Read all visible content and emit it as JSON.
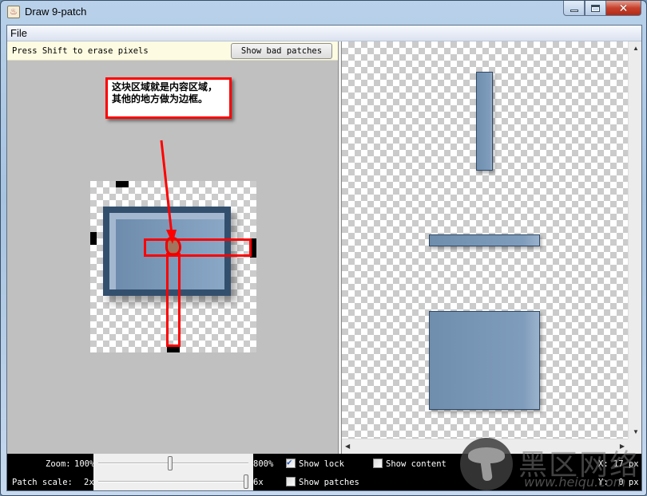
{
  "window": {
    "title": "Draw 9-patch",
    "app_icon": "java-cup-icon",
    "controls": {
      "minimize": "minimize-icon",
      "maximize": "maximize-icon",
      "close": "close-icon"
    }
  },
  "menubar": {
    "items": [
      {
        "label": "File"
      }
    ]
  },
  "editor": {
    "hint": "Press Shift to erase pixels",
    "show_bad_patches_label": "Show bad patches",
    "annotation": {
      "lines": [
        "这块区域就是内容区域，",
        "其他的地方做为边框。"
      ]
    },
    "annotation_color": "#ff0000"
  },
  "preview": {
    "items": [
      {
        "name": "vertical-stretch-preview"
      },
      {
        "name": "horizontal-stretch-preview"
      },
      {
        "name": "both-stretch-preview"
      }
    ],
    "fill_color": "#7390b0"
  },
  "status": {
    "zoom_label": "Zoom:",
    "zoom_min": "100%",
    "zoom_max": "800%",
    "zoom_value_fraction": 0.48,
    "patch_scale_label": "Patch scale:",
    "patch_scale_min": "2x",
    "patch_scale_max": "6x",
    "patch_scale_value_fraction": 1.0,
    "checkboxes": [
      {
        "label": "Show lock",
        "checked": true
      },
      {
        "label": "Show patches",
        "checked": false
      },
      {
        "label": "Show content",
        "checked": false
      }
    ],
    "x_readout": "X: 17 px",
    "y_readout": "Y:  0 px"
  },
  "watermark": {
    "text_cn": "黑区网络",
    "text_en": "www.heiqu.com"
  }
}
